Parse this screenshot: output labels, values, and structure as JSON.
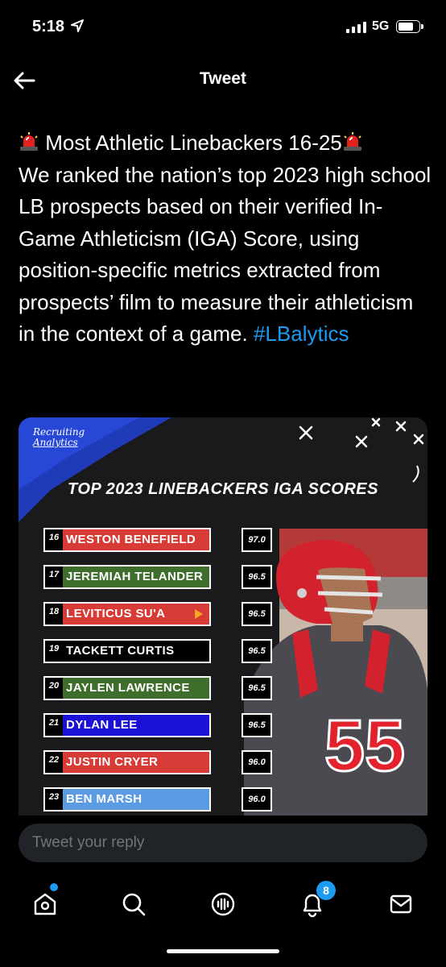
{
  "status_bar": {
    "time": "5:18",
    "network": "5G",
    "battery_level": 0.8
  },
  "header": {
    "title": "Tweet"
  },
  "tweet": {
    "title_line": "Most Athletic Linebackers 16-25",
    "body": "We ranked the nation’s top 2023 high school LB prospects based on their verified In-Game Athleticism (IGA) Score, using position-specific metrics extracted from prospects’ film to measure their athleticism in the context of a game.",
    "hashtag": "#LBalytics"
  },
  "media": {
    "logo_line1": "Recruiting",
    "logo_line2": "Analytics",
    "title": "TOP 2023 LINEBACKERS IGA SCORES",
    "jersey_number": "55",
    "rows": [
      {
        "rank": "16",
        "name": "WESTON BENEFIELD",
        "score": "97.0",
        "color": "#d83a35"
      },
      {
        "rank": "17",
        "name": "JEREMIAH TELANDER",
        "score": "96.5",
        "color": "#3f6d2c"
      },
      {
        "rank": "18",
        "name": "LEVITICUS SU'A",
        "score": "96.5",
        "color": "#d83a35"
      },
      {
        "rank": "19",
        "name": "TACKETT CURTIS",
        "score": "96.5",
        "color": "#000000"
      },
      {
        "rank": "20",
        "name": "JAYLEN LAWRENCE",
        "score": "96.5",
        "color": "#3f6d2c"
      },
      {
        "rank": "21",
        "name": "DYLAN LEE",
        "score": "96.5",
        "color": "#1b10d6"
      },
      {
        "rank": "22",
        "name": "JUSTIN CRYER",
        "score": "96.0",
        "color": "#d83a35"
      },
      {
        "rank": "23",
        "name": "BEN MARSH",
        "score": "96.0",
        "color": "#5b9be3"
      }
    ]
  },
  "reply": {
    "placeholder": "Tweet your reply"
  },
  "tabbar": {
    "notification_count": "8"
  },
  "colors": {
    "accent": "#1d9bf0",
    "background": "#000000",
    "input_bg": "#202327"
  }
}
